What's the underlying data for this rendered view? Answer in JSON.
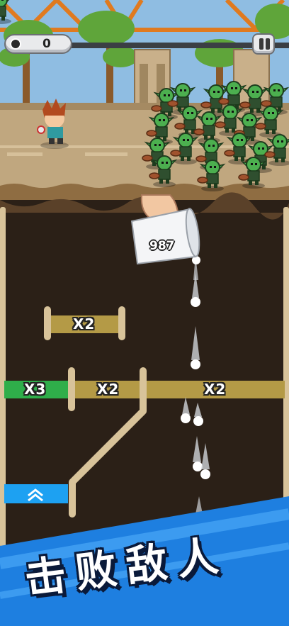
{
  "hud": {
    "counter_value": "0",
    "icons": {
      "counter": "ball-icon",
      "pause": "pause-icon"
    }
  },
  "cup": {
    "count": "987"
  },
  "multipliers": {
    "upper_gate": "X2",
    "left_gate": "X3",
    "middle_gate": "X2",
    "right_gate": "X2"
  },
  "banner": {
    "text": "击败敌人"
  },
  "colors": {
    "sky": "#89b9e0",
    "dirt": "#2b2017",
    "gate_gold": "#b49a46",
    "gate_green": "#2fae4a",
    "boost_blue": "#1da1f2",
    "banner_blue": "#1e7fe0",
    "goblin_green": "#4caf4f"
  }
}
